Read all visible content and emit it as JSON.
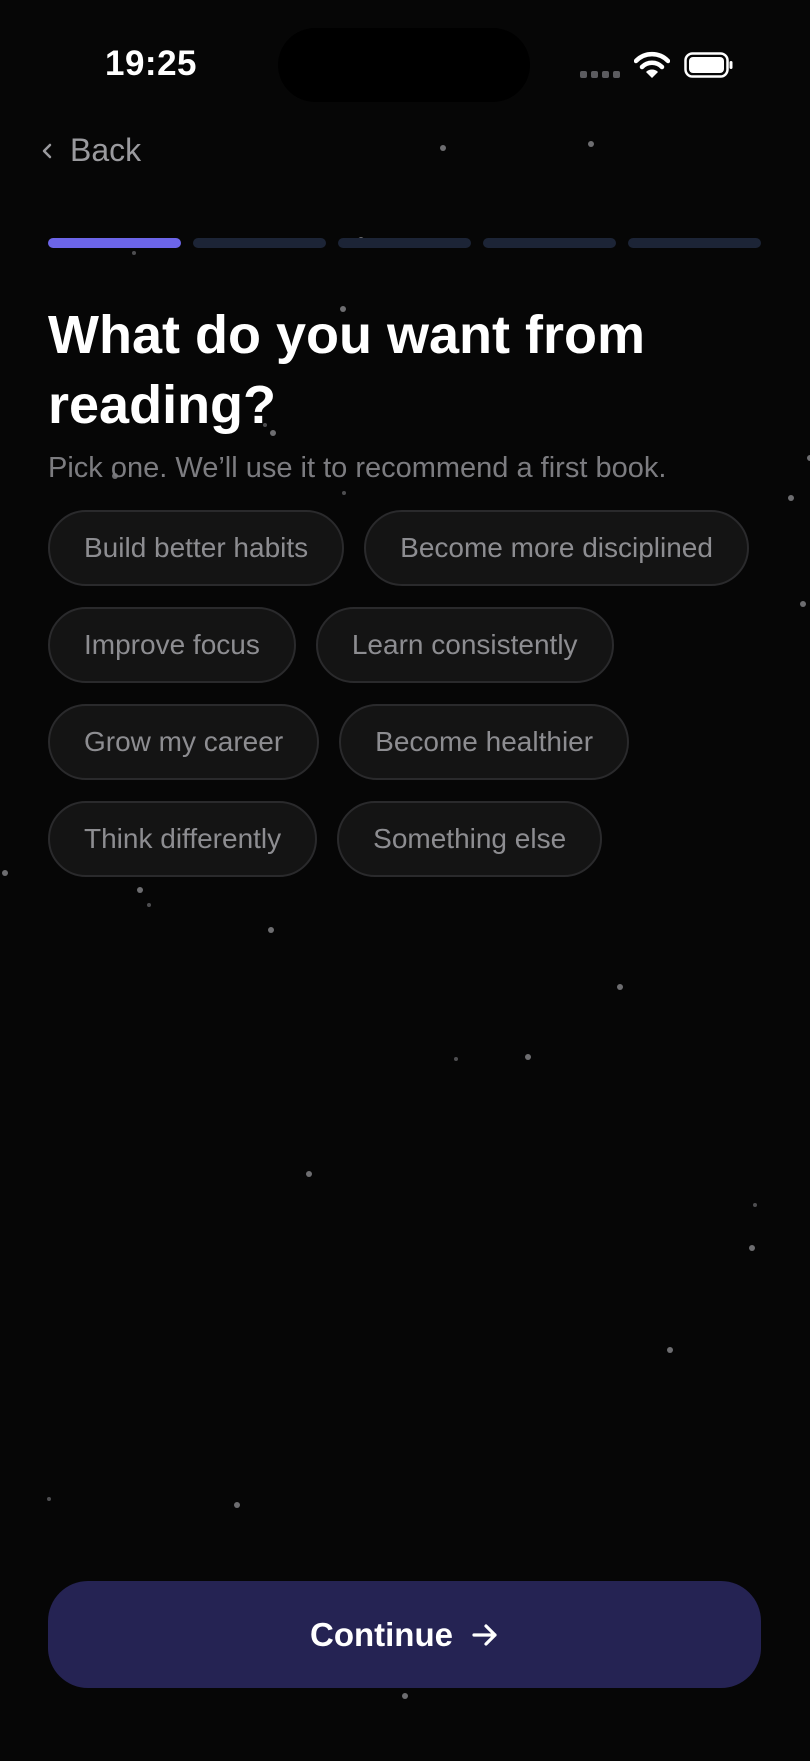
{
  "status_bar": {
    "time": "19:25",
    "icons": [
      "cellular-signal-icon",
      "wifi-icon",
      "battery-icon"
    ]
  },
  "nav": {
    "back_label": "Back",
    "back_icon": "chevron-left-icon"
  },
  "progress": {
    "total_steps": 5,
    "current_step": 1
  },
  "question": {
    "title": "What do you want from reading?",
    "subtitle": "Pick one. We’ll use it to recommend a first book."
  },
  "options": [
    "Build better habits",
    "Become more disciplined",
    "Improve focus",
    "Learn consistently",
    "Grow my career",
    "Become healthier",
    "Think differently",
    "Something else"
  ],
  "continue": {
    "label": "Continue",
    "icon": "arrow-right-icon"
  },
  "colors": {
    "background": "#060606",
    "accent": "#6c65e8",
    "progress_inactive": "#1c2436",
    "chip_background": "#141414",
    "chip_border": "#2a2a2c",
    "continue_background": "#252353",
    "muted_text": "#7c7c80"
  }
}
